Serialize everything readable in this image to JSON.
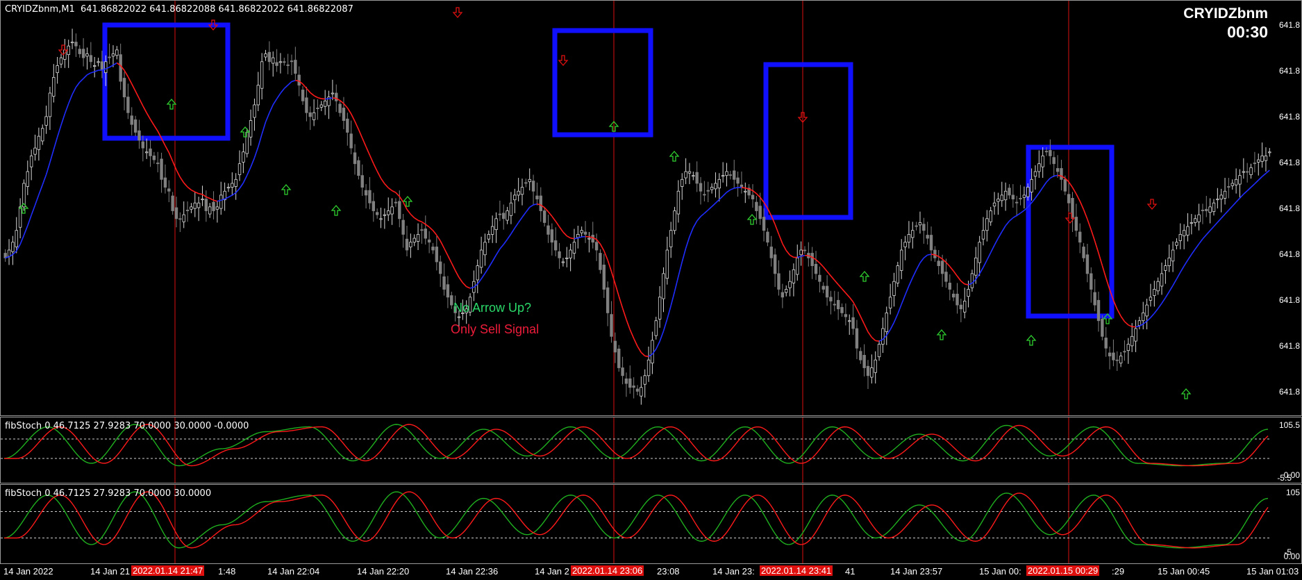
{
  "chart": {
    "header": "CRYIDZbnm,M1  641.86822022 641.86822088 641.86822022 641.86822087",
    "symbol": "CRYIDZbnm",
    "timer": "00:30",
    "notes": {
      "line1": "No Arrow Up?",
      "line2": "Only Sell Signal"
    },
    "price_ticks": [
      "641.8",
      "641.8",
      "641.8",
      "641.8",
      "641.8",
      "641.8",
      "641.8",
      "641.8",
      "641.8"
    ]
  },
  "indicator1": {
    "header": "fibStoch 0 46.7125 27.9283 70.0000 30.0000 -0.0000",
    "ticks": [
      "105.5",
      "0.00",
      "-5.5"
    ]
  },
  "indicator2": {
    "header": "fibStoch 0 46.7125 27.9283 70.0000 30.0000",
    "ticks": [
      "105",
      "-5",
      "0.00"
    ]
  },
  "time_axis": {
    "labels": [
      "14 Jan 2022",
      "14 Jan 21",
      "1:48",
      "14 Jan 22:04",
      "14 Jan 22:20",
      "14 Jan 22:36",
      "14 Jan 2",
      "23:08",
      "14 Jan 23:",
      "41",
      "14 Jan 23:57",
      "15 Jan 00:",
      ":29",
      "15 Jan 00:45",
      "15 Jan 01:03"
    ],
    "tags": [
      "2022.01.14 21:47",
      "2022.01.14 23:06",
      "2022.01.14 23:41",
      "2022.01.15 00:29"
    ]
  },
  "colors": {
    "bull": "#d9d9d9",
    "bear": "#808080",
    "ma_up": "#1f2eff",
    "ma_down": "#ff1a1a",
    "buy_arrow": "#2fd02f",
    "sell_arrow": "#e01010",
    "box": "#1010ff",
    "stoch_main": "#1fb01f",
    "stoch_signal": "#ff1a1a"
  },
  "chart_data": {
    "type": "candlestick",
    "price_series": [
      0.62,
      0.6,
      0.58,
      0.55,
      0.49,
      0.43,
      0.4,
      0.36,
      0.34,
      0.31,
      0.29,
      0.26,
      0.2,
      0.16,
      0.13,
      0.11,
      0.09,
      0.08,
      0.07,
      0.08,
      0.1,
      0.11,
      0.1,
      0.12,
      0.13,
      0.12,
      0.14,
      0.12,
      0.11,
      0.1,
      0.09,
      0.17,
      0.21,
      0.25,
      0.28,
      0.3,
      0.32,
      0.34,
      0.35,
      0.36,
      0.37,
      0.38,
      0.42,
      0.44,
      0.45,
      0.5,
      0.52,
      0.52,
      0.51,
      0.5,
      0.49,
      0.48,
      0.48,
      0.47,
      0.5,
      0.49,
      0.5,
      0.49,
      0.46,
      0.45,
      0.44,
      0.43,
      0.42,
      0.38,
      0.35,
      0.3,
      0.27,
      0.23,
      0.18,
      0.12,
      0.1,
      0.12,
      0.11,
      0.13,
      0.12,
      0.12,
      0.13,
      0.12,
      0.15,
      0.18,
      0.22,
      0.25,
      0.26,
      0.25,
      0.24,
      0.23,
      0.22,
      0.21,
      0.2,
      0.22,
      0.25,
      0.27,
      0.3,
      0.34,
      0.38,
      0.41,
      0.44,
      0.46,
      0.48,
      0.5,
      0.51,
      0.52,
      0.51,
      0.5,
      0.49,
      0.48,
      0.52,
      0.56,
      0.6,
      0.58,
      0.57,
      0.56,
      0.55,
      0.57,
      0.58,
      0.6,
      0.63,
      0.66,
      0.7,
      0.72,
      0.74,
      0.76,
      0.77,
      0.76,
      0.75,
      0.72,
      0.68,
      0.64,
      0.6,
      0.58,
      0.56,
      0.54,
      0.52,
      0.51,
      0.52,
      0.5,
      0.48,
      0.46,
      0.45,
      0.44,
      0.43,
      0.42,
      0.45,
      0.47,
      0.5,
      0.53,
      0.56,
      0.58,
      0.6,
      0.62,
      0.63,
      0.62,
      0.6,
      0.58,
      0.56,
      0.55,
      0.56,
      0.57,
      0.58,
      0.6,
      0.65,
      0.7,
      0.76,
      0.82,
      0.86,
      0.9,
      0.92,
      0.94,
      0.95,
      0.95,
      0.96,
      0.95,
      0.92,
      0.88,
      0.83,
      0.78,
      0.72,
      0.66,
      0.6,
      0.55,
      0.5,
      0.45,
      0.42,
      0.4,
      0.4,
      0.41,
      0.43,
      0.45,
      0.46,
      0.45,
      0.44,
      0.43,
      0.42,
      0.41,
      0.4,
      0.41,
      0.42,
      0.43,
      0.44,
      0.45,
      0.46,
      0.47,
      0.5,
      0.52,
      0.55,
      0.58,
      0.62,
      0.66,
      0.7,
      0.72,
      0.7,
      0.68,
      0.65,
      0.62,
      0.6,
      0.6,
      0.62,
      0.64,
      0.66,
      0.68,
      0.7,
      0.72,
      0.73,
      0.74,
      0.75,
      0.76,
      0.77,
      0.78,
      0.8,
      0.85,
      0.88,
      0.9,
      0.92,
      0.9,
      0.88,
      0.84,
      0.8,
      0.76,
      0.72,
      0.68,
      0.64,
      0.6,
      0.58,
      0.56,
      0.55,
      0.54,
      0.53,
      0.55,
      0.57,
      0.6,
      0.62,
      0.64,
      0.66,
      0.68,
      0.7,
      0.72,
      0.74,
      0.75,
      0.73,
      0.7,
      0.66,
      0.62,
      0.58,
      0.55,
      0.52,
      0.5,
      0.48,
      0.47,
      0.46,
      0.45,
      0.46,
      0.47,
      0.48,
      0.47,
      0.46,
      0.44,
      0.42,
      0.4,
      0.38,
      0.36,
      0.35,
      0.36,
      0.38,
      0.4,
      0.42,
      0.45,
      0.48,
      0.52,
      0.55,
      0.58,
      0.62,
      0.66,
      0.7,
      0.74,
      0.78,
      0.82,
      0.85,
      0.87,
      0.88,
      0.88,
      0.87,
      0.86,
      0.84,
      0.82,
      0.8,
      0.78,
      0.76,
      0.74,
      0.72,
      0.7,
      0.68,
      0.66,
      0.64,
      0.62,
      0.6,
      0.58,
      0.56,
      0.55,
      0.54,
      0.53,
      0.52,
      0.51,
      0.5,
      0.5,
      0.49,
      0.48,
      0.47,
      0.46,
      0.45,
      0.44,
      0.43,
      0.42,
      0.41,
      0.4,
      0.4,
      0.39,
      0.38,
      0.37,
      0.36,
      0.36,
      0.35
    ],
    "signals": {
      "buy_arrows_x": [
        33,
        246,
        352,
        411,
        483,
        586,
        883,
        970,
        1082,
        1244,
        1355,
        1484,
        1594,
        1707
      ],
      "sell_arrows_x": [
        90,
        306,
        658,
        810,
        1155,
        1540,
        1658
      ]
    },
    "signal_vlines_tags": [
      "2022.01.14 21:47",
      "2022.01.14 23:06",
      "2022.01.14 23:41",
      "2022.01.15 00:29"
    ],
    "stoch_levels": [
      70,
      30
    ]
  }
}
